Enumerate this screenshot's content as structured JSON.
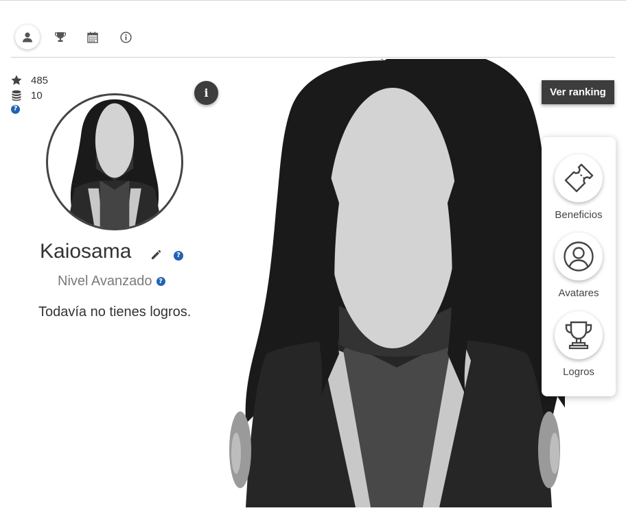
{
  "tabs": [
    {
      "icon": "user-icon",
      "active": true
    },
    {
      "icon": "trophy-icon",
      "active": false
    },
    {
      "icon": "calendar-icon",
      "active": false
    },
    {
      "icon": "info-icon",
      "active": false
    }
  ],
  "stats": {
    "points_value": "485",
    "coins_value": "10",
    "help_glyph": "?"
  },
  "profile": {
    "username": "Kaiosama",
    "level": "Nivel Avanzado",
    "achievements_empty": "Todavía no tienes logros.",
    "info_glyph": "i"
  },
  "actions": {
    "ranking_label": "Ver ranking"
  },
  "side_menu": {
    "benefits_label": "Beneficios",
    "avatars_label": "Avatares",
    "achievements_label": "Logros"
  },
  "colors": {
    "accent_help": "#1f63b4",
    "dark_button": "#3d3d3d",
    "avatar_hair": "#1a1a1a",
    "avatar_face": "#d3d3d3"
  }
}
